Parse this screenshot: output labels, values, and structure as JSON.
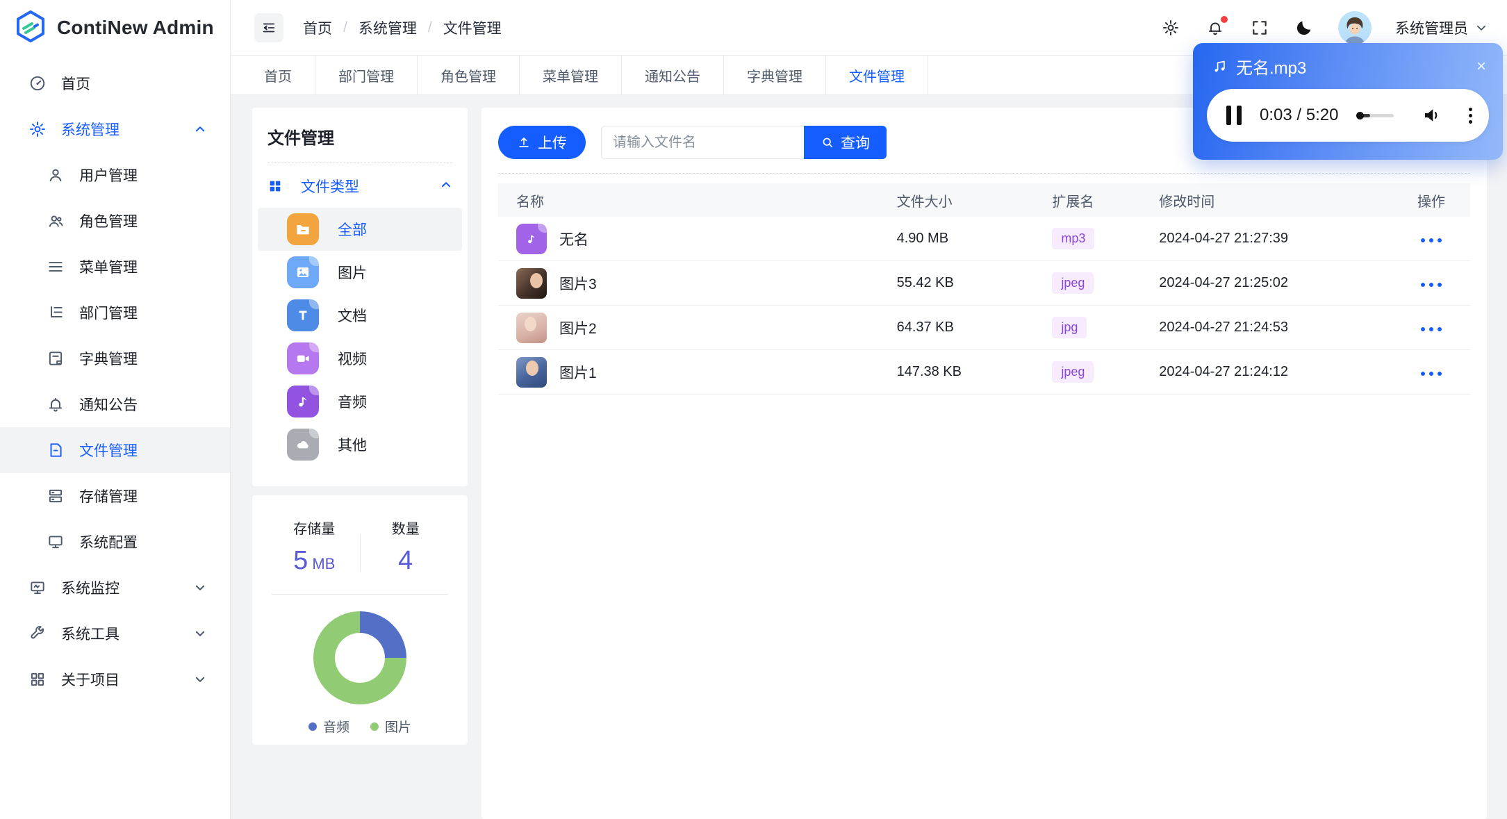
{
  "brand": {
    "name": "ContiNew Admin"
  },
  "header": {
    "breadcrumb": [
      "首页",
      "系统管理",
      "文件管理"
    ],
    "user": {
      "name": "系统管理员"
    }
  },
  "tabs": [
    {
      "label": "首页"
    },
    {
      "label": "部门管理"
    },
    {
      "label": "角色管理"
    },
    {
      "label": "菜单管理"
    },
    {
      "label": "通知公告"
    },
    {
      "label": "字典管理"
    },
    {
      "label": "文件管理",
      "active": true
    }
  ],
  "sidebar": {
    "items": [
      {
        "label": "首页"
      },
      {
        "label": "系统管理",
        "expanded": true,
        "children": [
          {
            "label": "用户管理"
          },
          {
            "label": "角色管理"
          },
          {
            "label": "菜单管理"
          },
          {
            "label": "部门管理"
          },
          {
            "label": "字典管理"
          },
          {
            "label": "通知公告"
          },
          {
            "label": "文件管理",
            "active": true
          },
          {
            "label": "存储管理"
          },
          {
            "label": "系统配置"
          }
        ]
      },
      {
        "label": "系统监控"
      },
      {
        "label": "系统工具"
      },
      {
        "label": "关于项目"
      }
    ]
  },
  "filter_panel": {
    "title": "文件管理",
    "group_label": "文件类型",
    "types": [
      {
        "label": "全部",
        "color": "#F2A53F",
        "active": true
      },
      {
        "label": "图片",
        "color": "#6EA9F8"
      },
      {
        "label": "文档",
        "color": "#4E8BE6"
      },
      {
        "label": "视频",
        "color": "#B678EE"
      },
      {
        "label": "音频",
        "color": "#9353E1"
      },
      {
        "label": "其他",
        "color": "#A9ADB3"
      }
    ]
  },
  "stats": {
    "storage_label": "存储量",
    "storage_value": "5",
    "storage_unit": "MB",
    "count_label": "数量",
    "count_value": "4"
  },
  "chart_data": {
    "type": "pie",
    "subtype": "donut",
    "categories": [
      "音频",
      "图片"
    ],
    "values": [
      1,
      3
    ],
    "colors": [
      "#5470C6",
      "#91CC75"
    ],
    "legend_position": "bottom",
    "title": ""
  },
  "toolbar": {
    "upload_label": "上传",
    "search_placeholder": "请输入文件名",
    "search_value": "",
    "query_label": "查询"
  },
  "table": {
    "columns": [
      "名称",
      "文件大小",
      "扩展名",
      "修改时间",
      "操作"
    ],
    "rows": [
      {
        "name": "无名",
        "size": "4.90 MB",
        "ext": "mp3",
        "time": "2024-04-27 21:27:39"
      },
      {
        "name": "图片3",
        "size": "55.42 KB",
        "ext": "jpeg",
        "time": "2024-04-27 21:25:02"
      },
      {
        "name": "图片2",
        "size": "64.37 KB",
        "ext": "jpg",
        "time": "2024-04-27 21:24:53"
      },
      {
        "name": "图片1",
        "size": "147.38 KB",
        "ext": "jpeg",
        "time": "2024-04-27 21:24:12"
      }
    ]
  },
  "player": {
    "title": "无名.mp3",
    "time": "0:03 / 5:20",
    "progress_percent": 35
  },
  "colors": {
    "primary": "#165DFF",
    "tag_bg": "#F6ECFE",
    "tag_text": "#8C46D8",
    "stat_value": "#5A5BD5",
    "player_gradient_start": "#2667F0",
    "player_gradient_end": "#93B9FA"
  }
}
